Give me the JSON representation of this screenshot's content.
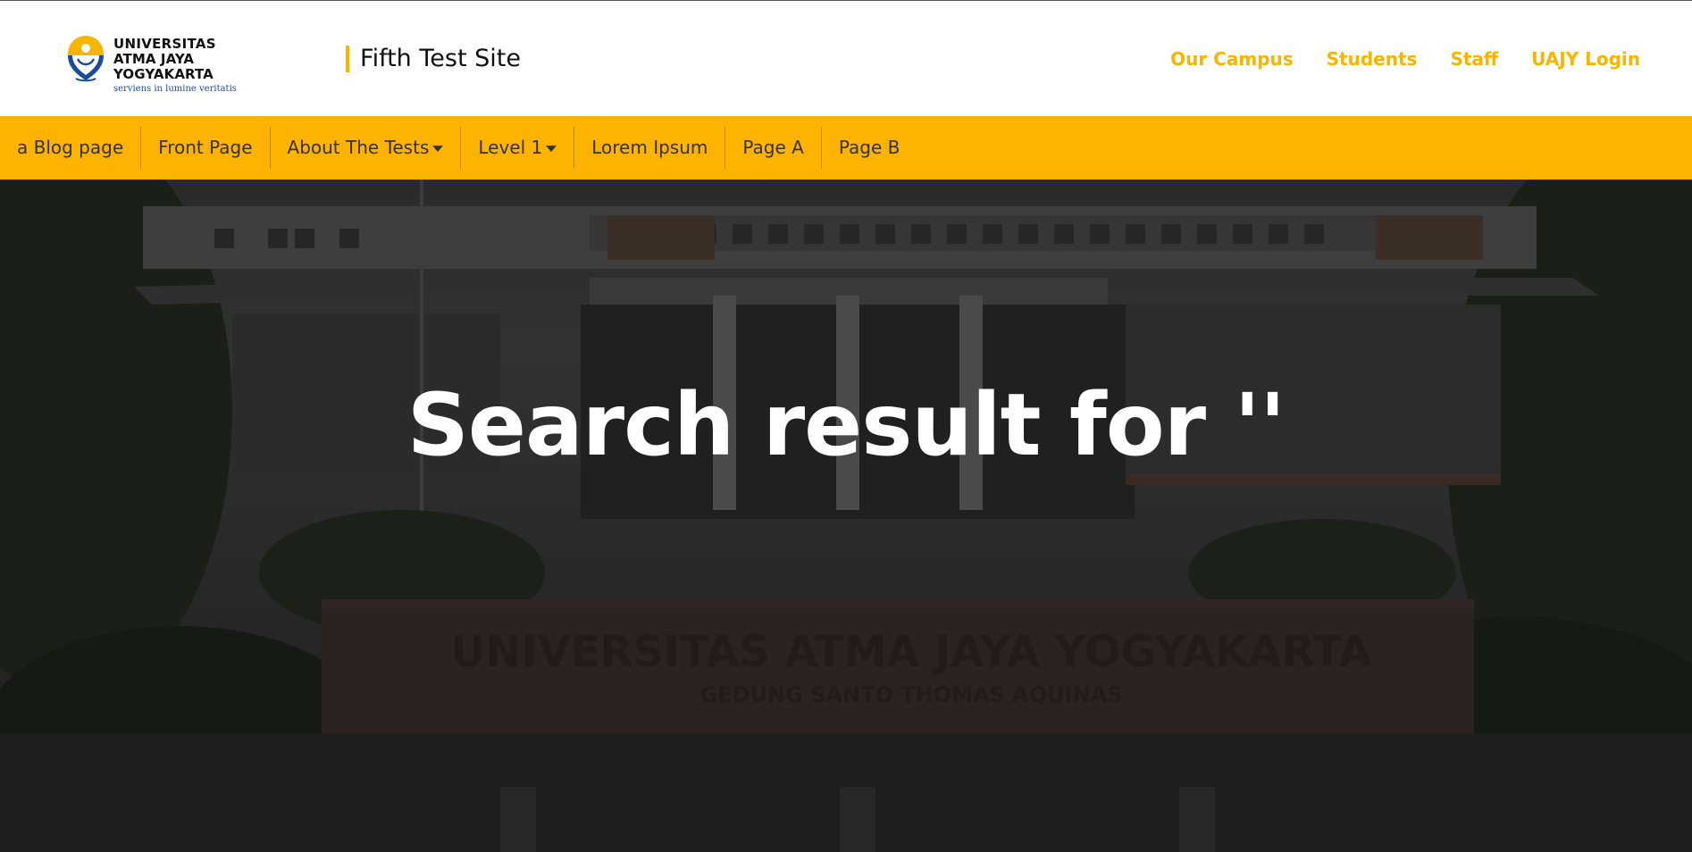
{
  "header": {
    "logo": {
      "line1": "UNIVERSITAS",
      "line2": "ATMA JAYA YOGYAKARTA",
      "tagline": "serviens in lumine veritatis"
    },
    "site_title": "Fifth Test Site",
    "top_links": [
      "Our Campus",
      "Students",
      "Staff",
      "UAJY Login"
    ]
  },
  "nav": {
    "items": [
      {
        "label": "a Blog page",
        "dropdown": false
      },
      {
        "label": "Front Page",
        "dropdown": false
      },
      {
        "label": "About The Tests",
        "dropdown": true
      },
      {
        "label": "Level 1",
        "dropdown": true
      },
      {
        "label": "Lorem Ipsum",
        "dropdown": false
      },
      {
        "label": "Page A",
        "dropdown": false
      },
      {
        "label": "Page B",
        "dropdown": false
      }
    ]
  },
  "hero": {
    "title": "Search result for ''",
    "background_sign_line1": "UNIVERSITAS ATMA JAYA YOGYAKARTA",
    "background_sign_line2": "GEDUNG SANTO THOMAS AQUINAS"
  },
  "colors": {
    "accent": "#fdb300",
    "link": "#f7b500",
    "nav_text": "#333333",
    "hero_text": "#ffffff"
  }
}
